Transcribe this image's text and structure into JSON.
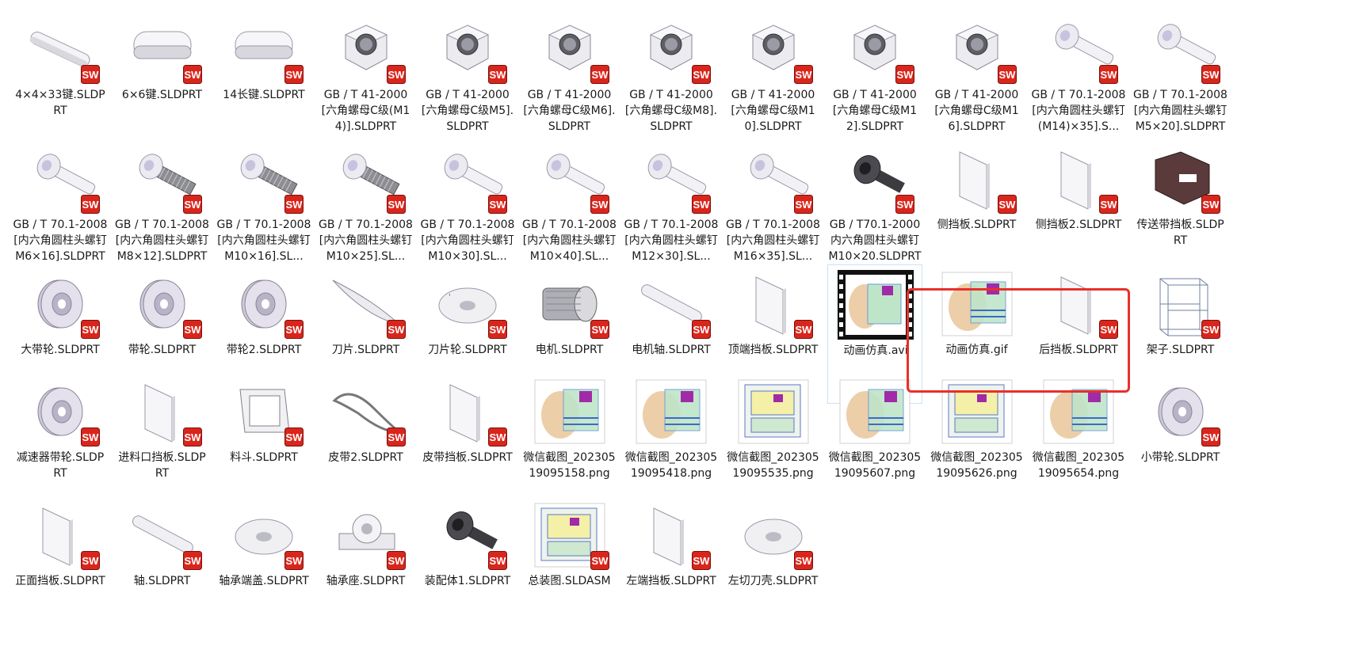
{
  "files": [
    {
      "name": "4×4×33键.SLDPRT",
      "thumb": "key",
      "badge": true
    },
    {
      "name": "6×6键.SLDPRT",
      "thumb": "key2",
      "badge": true
    },
    {
      "name": "14长键.SLDPRT",
      "thumb": "key2",
      "badge": true
    },
    {
      "name": "GB / T 41-2000[六角螺母C级(M14)].SLDPRT",
      "thumb": "nut",
      "badge": true
    },
    {
      "name": "GB / T 41-2000[六角螺母C级M5].SLDPRT",
      "thumb": "nut",
      "badge": true
    },
    {
      "name": "GB / T 41-2000[六角螺母C级M6].SLDPRT",
      "thumb": "nut",
      "badge": true
    },
    {
      "name": "GB / T 41-2000[六角螺母C级M8].SLDPRT",
      "thumb": "nut",
      "badge": true
    },
    {
      "name": "GB / T 41-2000[六角螺母C级M10].SLDPRT",
      "thumb": "nut",
      "badge": true
    },
    {
      "name": "GB / T 41-2000[六角螺母C级M12].SLDPRT",
      "thumb": "nut",
      "badge": true
    },
    {
      "name": "GB / T 41-2000[六角螺母C级M16].SLDPRT",
      "thumb": "nut",
      "badge": true
    },
    {
      "name": "GB / T 70.1-2008[内六角圆柱头螺钉(M14)×35].S...",
      "thumb": "screw",
      "badge": true
    },
    {
      "name": "GB / T 70.1-2008[内六角圆柱头螺钉M5×20].SLDPRT",
      "thumb": "screw",
      "badge": true
    },
    {
      "name": "GB / T 70.1-2008[内六角圆柱头螺钉M6×16].SLDPRT",
      "thumb": "screw",
      "badge": true
    },
    {
      "name": "GB / T 70.1-2008[内六角圆柱头螺钉M8×12].SLDPRT",
      "thumb": "screwt",
      "badge": true
    },
    {
      "name": "GB / T 70.1-2008[内六角圆柱头螺钉M10×16].SL...",
      "thumb": "screwt",
      "badge": true
    },
    {
      "name": "GB / T 70.1-2008[内六角圆柱头螺钉M10×25].SL...",
      "thumb": "screwt",
      "badge": true
    },
    {
      "name": "GB / T 70.1-2008[内六角圆柱头螺钉M10×30].SL...",
      "thumb": "screw",
      "badge": true
    },
    {
      "name": "GB / T 70.1-2008[内六角圆柱头螺钉M10×40].SL...",
      "thumb": "screw",
      "badge": true
    },
    {
      "name": "GB / T 70.1-2008[内六角圆柱头螺钉M12×30].SL...",
      "thumb": "screw",
      "badge": true
    },
    {
      "name": "GB / T 70.1-2008[内六角圆柱头螺钉M16×35].SL...",
      "thumb": "screw",
      "badge": true
    },
    {
      "name": "GB / T70.1-2000内六角圆柱头螺钉M10×20.SLDPRT",
      "thumb": "darkscrew",
      "badge": true
    },
    {
      "name": "侧挡板.SLDPRT",
      "thumb": "plate",
      "badge": true
    },
    {
      "name": "侧挡板2.SLDPRT",
      "thumb": "plate",
      "badge": true
    },
    {
      "name": "传送带挡板.SLDPRT",
      "thumb": "brownblock",
      "badge": true
    },
    {
      "name": "大带轮.SLDPRT",
      "thumb": "pulley",
      "badge": true
    },
    {
      "name": "带轮.SLDPRT",
      "thumb": "pulley",
      "badge": true
    },
    {
      "name": "带轮2.SLDPRT",
      "thumb": "pulley",
      "badge": true
    },
    {
      "name": "刀片.SLDPRT",
      "thumb": "blade",
      "badge": true
    },
    {
      "name": "刀片轮.SLDPRT",
      "thumb": "disc",
      "badge": true
    },
    {
      "name": "电机.SLDPRT",
      "thumb": "motor",
      "badge": true
    },
    {
      "name": "电机轴.SLDPRT",
      "thumb": "shaft",
      "badge": true
    },
    {
      "name": "顶端挡板.SLDPRT",
      "thumb": "plate",
      "badge": true
    },
    {
      "name": "动画仿真.avi",
      "thumb": "video",
      "badge": false,
      "selected": true
    },
    {
      "name": "动画仿真.gif",
      "thumb": "machine",
      "badge": false
    },
    {
      "name": "后挡板.SLDPRT",
      "thumb": "plate",
      "badge": true
    },
    {
      "name": "架子.SLDPRT",
      "thumb": "frame",
      "badge": true
    },
    {
      "name": "减速器带轮.SLDPRT",
      "thumb": "pulley",
      "badge": true
    },
    {
      "name": "进料口挡板.SLDPRT",
      "thumb": "plate",
      "badge": true
    },
    {
      "name": "料斗.SLDPRT",
      "thumb": "hopper",
      "badge": true
    },
    {
      "name": "皮带2.SLDPRT",
      "thumb": "belt",
      "badge": true
    },
    {
      "name": "皮带挡板.SLDPRT",
      "thumb": "plate",
      "badge": true
    },
    {
      "name": "微信截图_20230519095158.png",
      "thumb": "machine",
      "badge": false
    },
    {
      "name": "微信截图_20230519095418.png",
      "thumb": "machine",
      "badge": false
    },
    {
      "name": "微信截图_20230519095535.png",
      "thumb": "machine2",
      "badge": false
    },
    {
      "name": "微信截图_20230519095607.png",
      "thumb": "machine",
      "badge": false
    },
    {
      "name": "微信截图_20230519095626.png",
      "thumb": "machine2",
      "badge": false
    },
    {
      "name": "微信截图_20230519095654.png",
      "thumb": "machine",
      "badge": false
    },
    {
      "name": "小带轮.SLDPRT",
      "thumb": "pulley",
      "badge": true
    },
    {
      "name": "正面挡板.SLDPRT",
      "thumb": "plate",
      "badge": true
    },
    {
      "name": "轴.SLDPRT",
      "thumb": "shaft",
      "badge": true
    },
    {
      "name": "轴承端盖.SLDPRT",
      "thumb": "disc",
      "badge": true
    },
    {
      "name": "轴承座.SLDPRT",
      "thumb": "bearing",
      "badge": true
    },
    {
      "name": "装配体1.SLDPRT",
      "thumb": "darkscrew",
      "badge": true
    },
    {
      "name": "总装图.SLDASM",
      "thumb": "machine2",
      "badge": true
    },
    {
      "name": "左端挡板.SLDPRT",
      "thumb": "plate",
      "badge": true
    },
    {
      "name": "左切刀壳.SLDPRT",
      "thumb": "disc",
      "badge": true
    }
  ],
  "colors": {
    "highlight": "#e8302a",
    "selection": "#c9e2f6",
    "sw_red": "#d9261c"
  }
}
